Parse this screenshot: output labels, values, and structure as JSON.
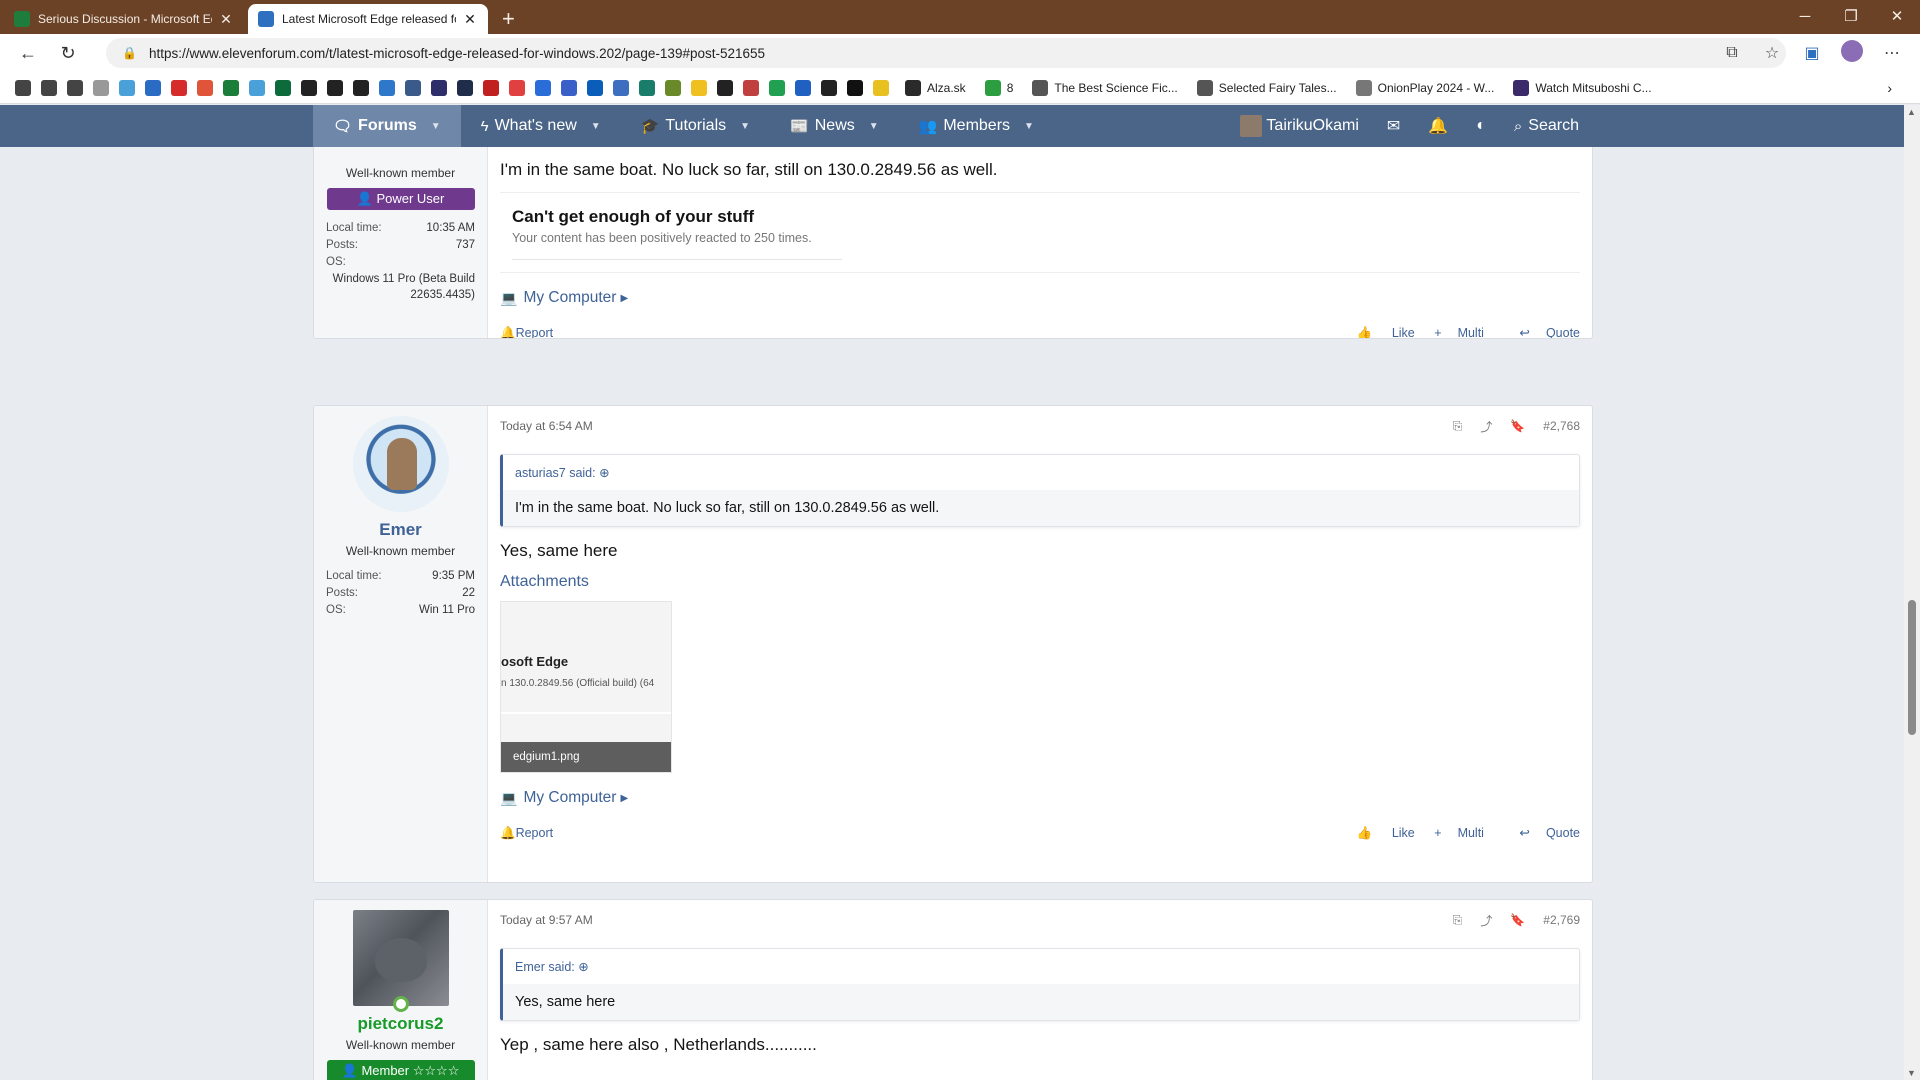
{
  "tabs": [
    {
      "title": "Serious Discussion - Microsoft Ed",
      "active": false,
      "favicon_color": "#1e7d3c"
    },
    {
      "title": "Latest Microsoft Edge released fo",
      "active": true,
      "favicon_color": "#2f6fbf"
    }
  ],
  "address": {
    "url": "https://www.elevenforum.com/t/latest-microsoft-edge-released-for-windows.202/page-139#post-521655"
  },
  "favorites": [
    {
      "label": "Alza.sk",
      "color": "#2a2a2a"
    },
    {
      "label": "8",
      "color": "#2c9e3f"
    },
    {
      "label": "The Best Science Fic...",
      "color": "#555555"
    },
    {
      "label": "Selected Fairy Tales...",
      "color": "#555555"
    },
    {
      "label": "OnionPlay 2024 - W...",
      "color": "#777777"
    },
    {
      "label": "Watch Mitsuboshi C...",
      "color": "#3a2a6a"
    }
  ],
  "favicon_strip_colors": [
    "#444",
    "#444",
    "#444",
    "#999",
    "#4aa0d8",
    "#2a6cc4",
    "#d62b2b",
    "#e0553a",
    "#1a7d3a",
    "#4aa0d8",
    "#0d6b3b",
    "#222",
    "#222",
    "#222",
    "#2d78c8",
    "#3a5a8a",
    "#2d2d6a",
    "#1f2d4a",
    "#c02020",
    "#e04040",
    "#2a6cd8",
    "#3860c8",
    "#0a5db8",
    "#3d6ec0",
    "#1a7d6a",
    "#6a8a2a",
    "#f0c020",
    "#222",
    "#c04040",
    "#20a050",
    "#2060c0",
    "#222",
    "#111",
    "#e8c020"
  ],
  "sitenav": {
    "items": [
      {
        "label": "Forums",
        "icon": "chat-bubbles-icon",
        "active": true
      },
      {
        "label": "What's new",
        "icon": "lightning-icon",
        "active": false
      },
      {
        "label": "Tutorials",
        "icon": "graduation-cap-icon",
        "active": false
      },
      {
        "label": "News",
        "icon": "newspaper-icon",
        "active": false
      },
      {
        "label": "Members",
        "icon": "users-icon",
        "active": false
      }
    ],
    "username": "TairikuOkami",
    "search_label": "Search"
  },
  "posts": [
    {
      "user": {
        "title": "Well-known member",
        "badge": "Power User",
        "local_time_label": "Local time:",
        "local_time": "10:35 AM",
        "posts_label": "Posts:",
        "posts": "737",
        "os_label": "OS:",
        "os": "Windows 11 Pro (Beta Build 22635.4435)"
      },
      "message": "I'm in the same boat. No luck so far, still on 130.0.2849.56 as well.",
      "signature_title": "Can't get enough of your stuff",
      "signature_sub": "Your content has been positively reacted to 250 times.",
      "my_computer": "My Computer",
      "report": "Report",
      "like": "Like",
      "multi": "Multi",
      "quote": "Quote"
    },
    {
      "user": {
        "name": "Emer",
        "title": "Well-known member",
        "local_time_label": "Local time:",
        "local_time": "9:35 PM",
        "posts_label": "Posts:",
        "posts": "22",
        "os_label": "OS:",
        "os": "Win 11 Pro"
      },
      "date": "Today at 6:54 AM",
      "number": "#2,768",
      "quote_author": "asturias7 said:",
      "quote_text": "I'm in the same boat. No luck so far, still on 130.0.2849.56 as well.",
      "message": "Yes, same here",
      "attachments_label": "Attachments",
      "attachment": {
        "line1": "osoft Edge",
        "line2": "n 130.0.2849.56 (Official build) (64",
        "caption": "edgium1.png"
      },
      "my_computer": "My Computer",
      "report": "Report",
      "like": "Like",
      "multi": "Multi",
      "quote": "Quote"
    },
    {
      "user": {
        "name": "pietcorus2",
        "title": "Well-known member",
        "badge": "Member"
      },
      "date": "Today at 9:57 AM",
      "number": "#2,769",
      "quote_author": "Emer said:",
      "quote_text": "Yes, same here",
      "message": "Yep , same here also , Netherlands..........."
    }
  ]
}
